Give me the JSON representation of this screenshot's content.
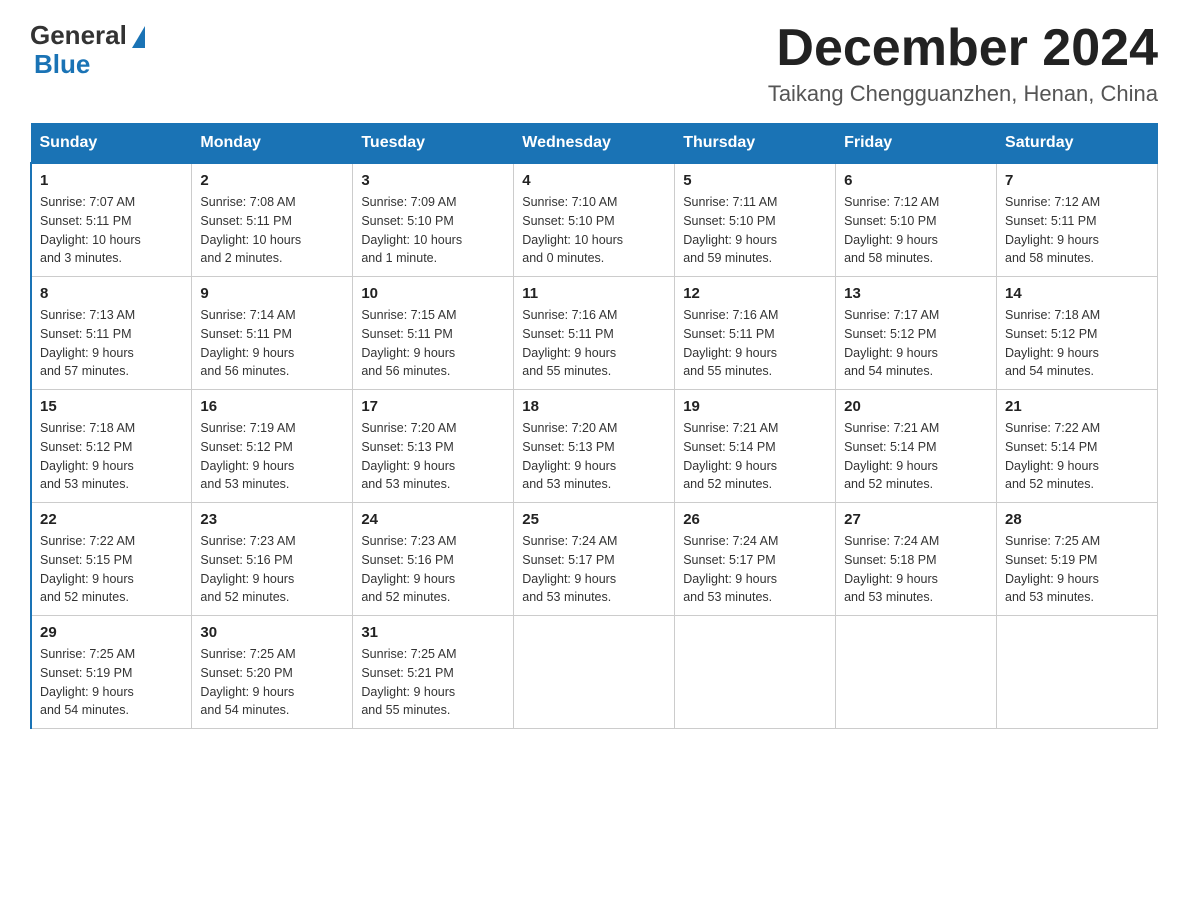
{
  "header": {
    "logo_general": "General",
    "logo_blue": "Blue",
    "month_title": "December 2024",
    "location": "Taikang Chengguanzhen, Henan, China"
  },
  "weekdays": [
    "Sunday",
    "Monday",
    "Tuesday",
    "Wednesday",
    "Thursday",
    "Friday",
    "Saturday"
  ],
  "weeks": [
    [
      {
        "day": "1",
        "sunrise": "7:07 AM",
        "sunset": "5:11 PM",
        "daylight": "10 hours and 3 minutes."
      },
      {
        "day": "2",
        "sunrise": "7:08 AM",
        "sunset": "5:11 PM",
        "daylight": "10 hours and 2 minutes."
      },
      {
        "day": "3",
        "sunrise": "7:09 AM",
        "sunset": "5:10 PM",
        "daylight": "10 hours and 1 minute."
      },
      {
        "day": "4",
        "sunrise": "7:10 AM",
        "sunset": "5:10 PM",
        "daylight": "10 hours and 0 minutes."
      },
      {
        "day": "5",
        "sunrise": "7:11 AM",
        "sunset": "5:10 PM",
        "daylight": "9 hours and 59 minutes."
      },
      {
        "day": "6",
        "sunrise": "7:12 AM",
        "sunset": "5:10 PM",
        "daylight": "9 hours and 58 minutes."
      },
      {
        "day": "7",
        "sunrise": "7:12 AM",
        "sunset": "5:11 PM",
        "daylight": "9 hours and 58 minutes."
      }
    ],
    [
      {
        "day": "8",
        "sunrise": "7:13 AM",
        "sunset": "5:11 PM",
        "daylight": "9 hours and 57 minutes."
      },
      {
        "day": "9",
        "sunrise": "7:14 AM",
        "sunset": "5:11 PM",
        "daylight": "9 hours and 56 minutes."
      },
      {
        "day": "10",
        "sunrise": "7:15 AM",
        "sunset": "5:11 PM",
        "daylight": "9 hours and 56 minutes."
      },
      {
        "day": "11",
        "sunrise": "7:16 AM",
        "sunset": "5:11 PM",
        "daylight": "9 hours and 55 minutes."
      },
      {
        "day": "12",
        "sunrise": "7:16 AM",
        "sunset": "5:11 PM",
        "daylight": "9 hours and 55 minutes."
      },
      {
        "day": "13",
        "sunrise": "7:17 AM",
        "sunset": "5:12 PM",
        "daylight": "9 hours and 54 minutes."
      },
      {
        "day": "14",
        "sunrise": "7:18 AM",
        "sunset": "5:12 PM",
        "daylight": "9 hours and 54 minutes."
      }
    ],
    [
      {
        "day": "15",
        "sunrise": "7:18 AM",
        "sunset": "5:12 PM",
        "daylight": "9 hours and 53 minutes."
      },
      {
        "day": "16",
        "sunrise": "7:19 AM",
        "sunset": "5:12 PM",
        "daylight": "9 hours and 53 minutes."
      },
      {
        "day": "17",
        "sunrise": "7:20 AM",
        "sunset": "5:13 PM",
        "daylight": "9 hours and 53 minutes."
      },
      {
        "day": "18",
        "sunrise": "7:20 AM",
        "sunset": "5:13 PM",
        "daylight": "9 hours and 53 minutes."
      },
      {
        "day": "19",
        "sunrise": "7:21 AM",
        "sunset": "5:14 PM",
        "daylight": "9 hours and 52 minutes."
      },
      {
        "day": "20",
        "sunrise": "7:21 AM",
        "sunset": "5:14 PM",
        "daylight": "9 hours and 52 minutes."
      },
      {
        "day": "21",
        "sunrise": "7:22 AM",
        "sunset": "5:14 PM",
        "daylight": "9 hours and 52 minutes."
      }
    ],
    [
      {
        "day": "22",
        "sunrise": "7:22 AM",
        "sunset": "5:15 PM",
        "daylight": "9 hours and 52 minutes."
      },
      {
        "day": "23",
        "sunrise": "7:23 AM",
        "sunset": "5:16 PM",
        "daylight": "9 hours and 52 minutes."
      },
      {
        "day": "24",
        "sunrise": "7:23 AM",
        "sunset": "5:16 PM",
        "daylight": "9 hours and 52 minutes."
      },
      {
        "day": "25",
        "sunrise": "7:24 AM",
        "sunset": "5:17 PM",
        "daylight": "9 hours and 53 minutes."
      },
      {
        "day": "26",
        "sunrise": "7:24 AM",
        "sunset": "5:17 PM",
        "daylight": "9 hours and 53 minutes."
      },
      {
        "day": "27",
        "sunrise": "7:24 AM",
        "sunset": "5:18 PM",
        "daylight": "9 hours and 53 minutes."
      },
      {
        "day": "28",
        "sunrise": "7:25 AM",
        "sunset": "5:19 PM",
        "daylight": "9 hours and 53 minutes."
      }
    ],
    [
      {
        "day": "29",
        "sunrise": "7:25 AM",
        "sunset": "5:19 PM",
        "daylight": "9 hours and 54 minutes."
      },
      {
        "day": "30",
        "sunrise": "7:25 AM",
        "sunset": "5:20 PM",
        "daylight": "9 hours and 54 minutes."
      },
      {
        "day": "31",
        "sunrise": "7:25 AM",
        "sunset": "5:21 PM",
        "daylight": "9 hours and 55 minutes."
      },
      null,
      null,
      null,
      null
    ]
  ],
  "labels": {
    "sunrise": "Sunrise:",
    "sunset": "Sunset:",
    "daylight": "Daylight:"
  }
}
